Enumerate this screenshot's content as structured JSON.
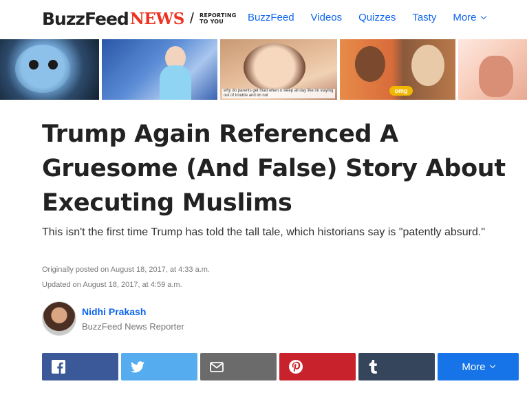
{
  "header": {
    "logo_buzzfeed": "BuzzFeed",
    "logo_news": "NEWS",
    "logo_slash": "/",
    "logo_tag_line1": "REPORTING",
    "logo_tag_line2": "TO YOU",
    "nav": [
      {
        "label": "BuzzFeed"
      },
      {
        "label": "Videos"
      },
      {
        "label": "Quizzes"
      },
      {
        "label": "Tasty"
      },
      {
        "label": "More"
      }
    ]
  },
  "strip": {
    "thumb3_caption": "why do parents get mad when u sleep all day like im staying out of trouble and im not",
    "thumb4_badge": "omg"
  },
  "article": {
    "headline": "Trump Again Referenced A Gruesome (And False) Story About Executing Muslims",
    "dek": "This isn't the first time Trump has told the tall tale, which historians say is \"patently absurd.\"",
    "posted": "Originally posted on August 18, 2017, at 4:33 a.m.",
    "updated": "Updated on August 18, 2017, at 4:59 a.m."
  },
  "author": {
    "name": "Nidhi Prakash",
    "role": "BuzzFeed News Reporter"
  },
  "share": {
    "buttons": [
      {
        "icon": "facebook-icon",
        "color": "#3b5998"
      },
      {
        "icon": "twitter-icon",
        "color": "#55acee"
      },
      {
        "icon": "email-icon",
        "color": "#6b6b6b"
      },
      {
        "icon": "pinterest-icon",
        "color": "#c8232c"
      },
      {
        "icon": "tumblr-icon",
        "color": "#35465c"
      }
    ],
    "more_label": "More",
    "more_color": "#1774e8"
  },
  "colors": {
    "link_blue": "#0f65ef",
    "news_red": "#ee3322"
  }
}
